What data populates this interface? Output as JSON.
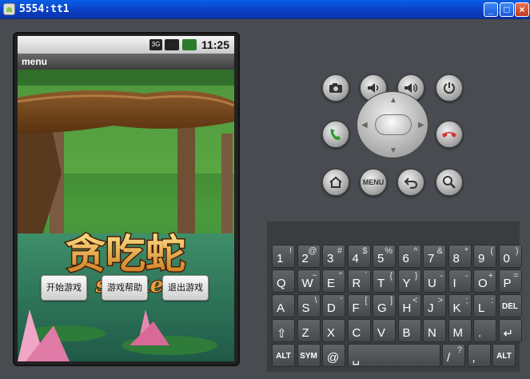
{
  "window": {
    "title": "5554:tt1",
    "buttons": {
      "minimize": "_",
      "maximize": "□",
      "close": "×"
    }
  },
  "status_bar": {
    "time": "11:25",
    "icons": [
      "3g-icon",
      "signal-icon",
      "battery-icon"
    ],
    "network_label": "3G"
  },
  "app_menu": {
    "label": "menu"
  },
  "game": {
    "title_cn": "贪吃蛇",
    "title_en": "snake",
    "buttons": [
      "开始游戏",
      "游戏帮助",
      "退出游戏"
    ]
  },
  "controls": {
    "top_row": [
      "camera-icon",
      "volume-down-icon",
      "volume-up-icon",
      "power-icon"
    ],
    "mid_row": [
      "call-icon",
      "dpad",
      "end-call-icon"
    ],
    "bottom_row": [
      "home-icon",
      "menu-button",
      "back-icon",
      "search-icon"
    ],
    "menu_label": "MENU"
  },
  "keyboard": {
    "rows": [
      [
        [
          "1",
          "!"
        ],
        [
          "2",
          "@"
        ],
        [
          "3",
          "#"
        ],
        [
          "4",
          "$"
        ],
        [
          "5",
          "%"
        ],
        [
          "6",
          "^"
        ],
        [
          "7",
          "&"
        ],
        [
          "8",
          "*"
        ],
        [
          "9",
          "("
        ],
        [
          "0",
          ")"
        ]
      ],
      [
        [
          "Q",
          ""
        ],
        [
          "W",
          "~"
        ],
        [
          "E",
          "\""
        ],
        [
          "R",
          "`"
        ],
        [
          "T",
          "{"
        ],
        [
          "Y",
          "}"
        ],
        [
          "U",
          "-"
        ],
        [
          "I",
          "-"
        ],
        [
          "O",
          "+"
        ],
        [
          "P",
          "="
        ]
      ],
      [
        [
          "A",
          ""
        ],
        [
          "S",
          "\\"
        ],
        [
          "D",
          "'"
        ],
        [
          "F",
          "["
        ],
        [
          "G",
          "]"
        ],
        [
          "H",
          "<"
        ],
        [
          "J",
          ">"
        ],
        [
          "K",
          ";"
        ],
        [
          "L",
          ":"
        ],
        [
          "DEL",
          ""
        ]
      ],
      [
        [
          "⇧",
          ""
        ],
        [
          "Z",
          ""
        ],
        [
          "X",
          ""
        ],
        [
          "C",
          ""
        ],
        [
          "V",
          ""
        ],
        [
          "B",
          ""
        ],
        [
          "N",
          ""
        ],
        [
          "M",
          ""
        ],
        [
          ".",
          ""
        ],
        [
          "↵",
          ""
        ]
      ],
      [
        [
          "ALT",
          ""
        ],
        [
          "SYM",
          ""
        ],
        [
          "@",
          ""
        ],
        [
          "␣",
          ""
        ],
        [
          "/",
          "?"
        ],
        [
          ",",
          ""
        ],
        [
          "ALT",
          ""
        ]
      ]
    ]
  }
}
